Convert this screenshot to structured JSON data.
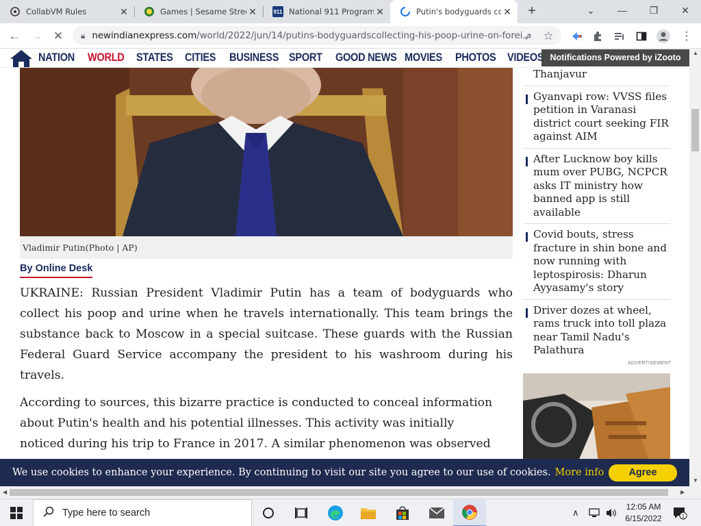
{
  "browser": {
    "tabs": [
      {
        "title": "CollabVM Rules",
        "icon": "collabvm-icon"
      },
      {
        "title": "Games | Sesame Street",
        "icon": "sesame-icon"
      },
      {
        "title": "National 911 Program",
        "icon": "911-icon",
        "badge": "911"
      },
      {
        "title": "Putin's bodyguards co",
        "icon": "loading-spinner-icon"
      }
    ],
    "new_tab": "+",
    "url_host": "newindianexpress.com",
    "url_path": "/world/2022/jun/14/putins-bodyguardscollecting-his-poop-urine-on-forei..."
  },
  "site": {
    "nav": [
      "NATION",
      "WORLD",
      "STATES",
      "CITIES",
      "BUSINESS",
      "SPORT",
      "GOOD NEWS",
      "MOVIES",
      "PHOTOS",
      "VIDEOS"
    ],
    "active_nav": "WORLD",
    "notification": "Notifications Powered by iZooto"
  },
  "article": {
    "caption": "Vladimir Putin(Photo | AP)",
    "byline": "By Online Desk",
    "p1": "UKRAINE: Russian President Vladimir Putin has a team of bodyguards who collect his poop and urine when he travels internationally. This team brings the substance back to Moscow in a special suitcase. These guards with the Russian Federal Guard Service accompany the president to his washroom during his travels.",
    "p2": "According to sources, this bizarre practice is conducted to conceal information about Putin's health and his potential illnesses. This activity was initially noticed during his trip to France in 2017. A similar phenomenon was observed during his"
  },
  "sidebar": {
    "items": [
      "Thanjavur",
      "Gyanvapi row: VVSS files petition in Varanasi district court seeking FIR against AIM",
      "After Lucknow boy kills mum over PUBG, NCPCR asks IT ministry how banned app is still available",
      "Covid bouts, stress fracture in shin bone and now running with leptospirosis: Dharun Ayyasamy's story",
      "Driver dozes at wheel, rams truck into toll plaza near Tamil Nadu's Palathura"
    ],
    "ad_label": "ADVERTISEMENT"
  },
  "cookie": {
    "text": "We use cookies to enhance your experience. By continuing to visit our site you agree to our use of cookies.",
    "more": "More info",
    "agree": "Agree"
  },
  "taskbar": {
    "search_placeholder": "Type here to search",
    "time": "12:05 AM",
    "date": "6/15/2022",
    "notification_count": "1"
  },
  "colors": {
    "brand_navy": "#1a2a5c",
    "brand_red": "#c8102e",
    "cookie_bg": "#1e2a4f",
    "agree_yellow": "#f4d000"
  }
}
